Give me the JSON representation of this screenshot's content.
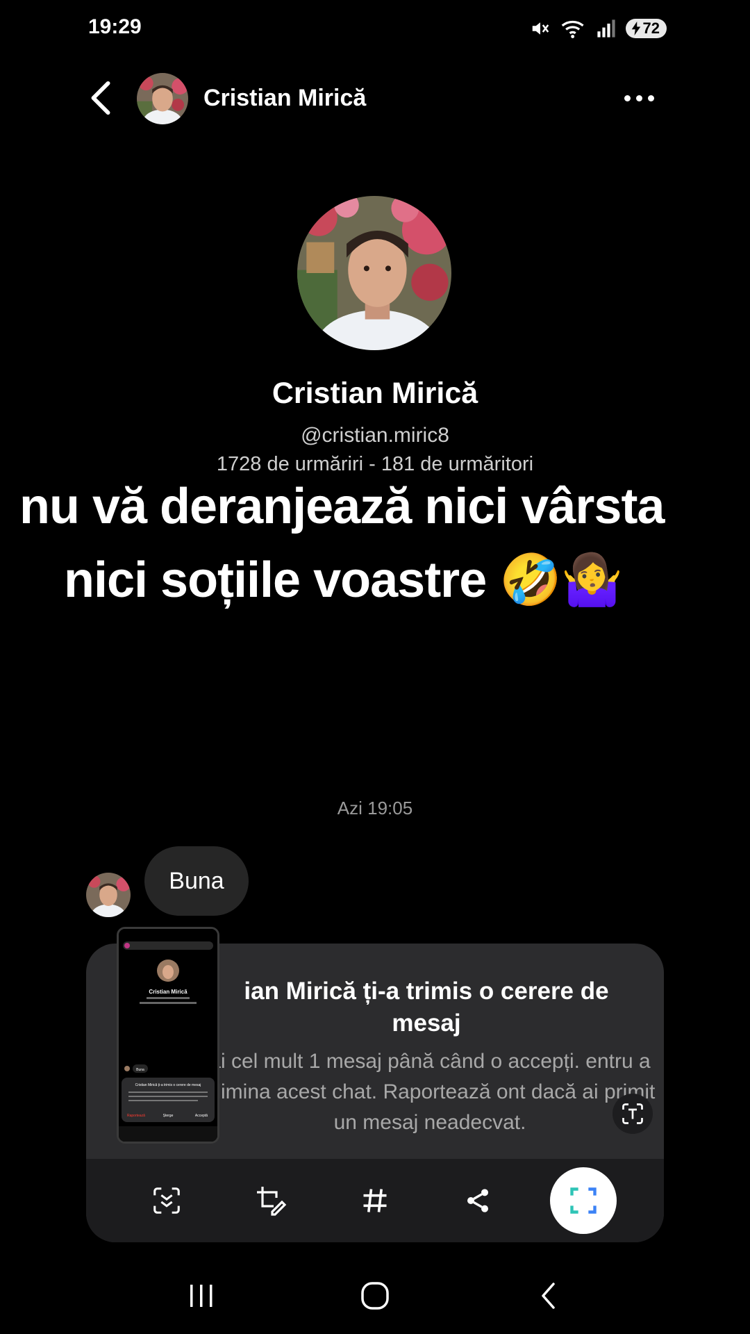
{
  "status_bar": {
    "time": "19:29",
    "battery": "72",
    "icons": [
      "mute-icon",
      "wifi-icon",
      "signal-icon",
      "battery-icon"
    ]
  },
  "header": {
    "name": "Cristian Mirică",
    "back_icon": "chevron-left-icon",
    "more_icon": "more-horizontal-icon"
  },
  "profile": {
    "name": "Cristian Mirică",
    "handle": "@cristian.miric8",
    "stats": "1728 de urmăriri - 181 de urmăritori"
  },
  "caption": {
    "line1": "nu vă deranjează nici vârsta",
    "line2": "nici soțiile voastre 🤣🤷‍♀️"
  },
  "chat": {
    "timestamp": "Azi 19:05",
    "message": "Buna"
  },
  "request_panel": {
    "title": "ian Mirică ți-a trimis o cerere de mesaj",
    "body": "ai cel mult 1 mesaj până când o accepți. entru a elimina acest chat. Raportează ont dacă ai primit un mesaj neadecvat."
  },
  "thumbnail": {
    "name": "Cristian Mirică",
    "request": "Cristian Mirică ți-a trimis o cerere de mesaj",
    "message": "Buna",
    "actions": [
      "Raportează",
      "Șterge",
      "Acceptă"
    ]
  },
  "screenshot_toolbar": {
    "tools": [
      "scroll-capture-icon",
      "crop-edit-icon",
      "hashtag-icon",
      "share-icon",
      "capture-area-icon"
    ]
  },
  "colors": {
    "background": "#000000",
    "bubble": "#262626",
    "panel": "#2c2c2e",
    "toolbar": "#1c1c1e",
    "danger": "#ff3b30",
    "accent": "#3897f0"
  },
  "nav_bar": {
    "buttons": [
      "recent-apps-icon",
      "home-icon",
      "back-icon"
    ]
  }
}
